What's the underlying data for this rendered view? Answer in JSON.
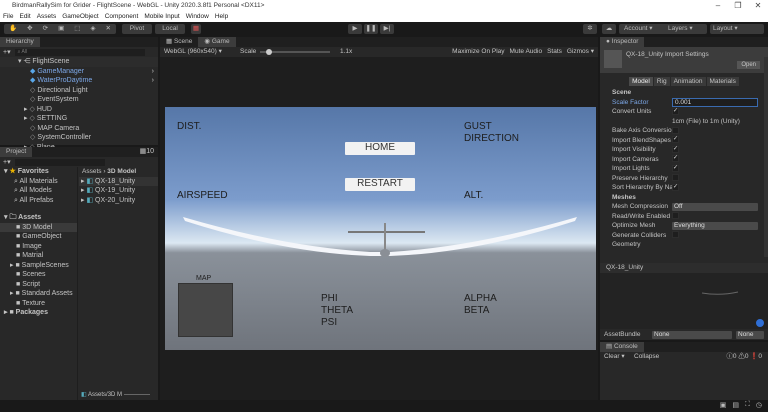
{
  "window": {
    "title": "BirdmanRallySim for Grider - FlightScene - WebGL - Unity 2020.3.8f1 Personal <DX11>",
    "minimize": "–",
    "maximize": "❐",
    "close": "✕"
  },
  "menu": [
    "File",
    "Edit",
    "Assets",
    "GameObject",
    "Component",
    "Mobile Input",
    "Window",
    "Help"
  ],
  "toolbar": {
    "pivot": "Pivot",
    "local": "Local",
    "account": "Account",
    "layers": "Layers",
    "layout": "Layout"
  },
  "hierarchy": {
    "tab": "Hierarchy",
    "search": "All",
    "scene": "FlightScene",
    "items": [
      {
        "label": "GameManager",
        "prefab": true,
        "arrow": false
      },
      {
        "label": "WaterProDaytime",
        "prefab": true,
        "arrow": false
      },
      {
        "label": "Directional Light",
        "prefab": false,
        "arrow": false
      },
      {
        "label": "EventSystem",
        "prefab": false,
        "arrow": false
      },
      {
        "label": "HUD",
        "prefab": false,
        "arrow": true
      },
      {
        "label": "SETTING",
        "prefab": false,
        "arrow": true
      },
      {
        "label": "MAP Camera",
        "prefab": false,
        "arrow": false
      },
      {
        "label": "SystemController",
        "prefab": false,
        "arrow": false
      },
      {
        "label": "Plane",
        "prefab": false,
        "arrow": true
      }
    ]
  },
  "project": {
    "tab": "Project",
    "count": "10",
    "favorites": "Favorites",
    "fav_items": [
      "All Materials",
      "All Models",
      "All Prefabs"
    ],
    "assets": "Assets",
    "folders": [
      "3D Model",
      "GameObject",
      "Image",
      "Matrial",
      "SampleScenes",
      "Scenes",
      "Script",
      "Standard Assets",
      "Texture"
    ],
    "packages": "Packages",
    "breadcrumb": [
      "Assets",
      "3D Model"
    ],
    "files": [
      "QX-18_Unity",
      "QX-19_Unity",
      "QX-20_Unity"
    ],
    "footer_path": "Assets/3D M"
  },
  "game": {
    "tabs": [
      "Scene",
      "Game"
    ],
    "resolution": "WebGL (960x540)",
    "scale_label": "Scale",
    "scale_value": "1.1x",
    "scale_fraction": 0.1,
    "options": [
      "Maximize On Play",
      "Mute Audio",
      "Stats",
      "Gizmos"
    ],
    "hud": {
      "dist": "DIST.",
      "gust": "GUST",
      "direction": "DIRECTION",
      "airspeed": "AIRSPEED",
      "alt": "ALT.",
      "home": "HOME",
      "restart": "RESTART",
      "map": "MAP",
      "phi": "PHI",
      "theta": "THETA",
      "psi": "PSI",
      "alpha": "ALPHA",
      "beta": "BETA"
    }
  },
  "inspector": {
    "tab": "Inspector",
    "title": "QX-18_Unity Import Settings",
    "open": "Open",
    "subtabs": [
      "Model",
      "Rig",
      "Animation",
      "Materials"
    ],
    "scene_header": "Scene",
    "scale_factor_label": "Scale Factor",
    "scale_factor": "0.001",
    "convert_units": "Convert Units",
    "convert_note": "1cm (File) to 1m (Unity)",
    "props": [
      {
        "label": "Bake Axis Conversio",
        "checked": false
      },
      {
        "label": "Import BlendShapes",
        "checked": true
      },
      {
        "label": "Import Visibility",
        "checked": true
      },
      {
        "label": "Import Cameras",
        "checked": true
      },
      {
        "label": "Import Lights",
        "checked": true
      },
      {
        "label": "Preserve Hierarchy",
        "checked": false
      },
      {
        "label": "Sort Hierarchy By Na",
        "checked": true
      }
    ],
    "meshes_header": "Meshes",
    "mesh_compression": "Mesh Compression",
    "mesh_compression_value": "Off",
    "read_write": "Read/Write Enabled",
    "optimize_mesh": "Optimize Mesh",
    "optimize_value": "Everything",
    "generate_colliders": "Generate Colliders",
    "geometry": "Geometry",
    "preview_title": "QX-18_Unity",
    "assetbundle": "AssetBundle",
    "bundle_value": "None",
    "bundle_variant": "None"
  },
  "console": {
    "tab": "Console",
    "clear": "Clear",
    "collapse": "Collapse",
    "logs": "0",
    "warnings": "0",
    "errors": "0"
  }
}
